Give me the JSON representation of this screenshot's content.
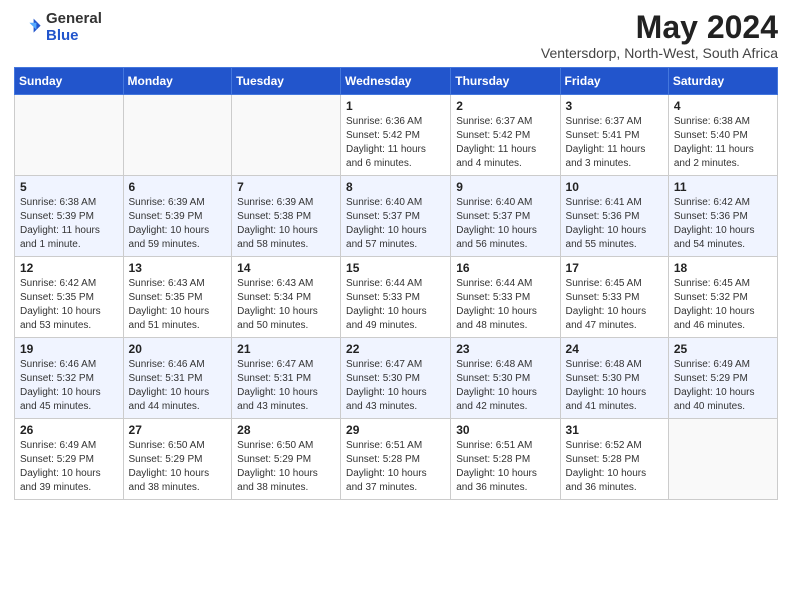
{
  "header": {
    "logo_general": "General",
    "logo_blue": "Blue",
    "month_title": "May 2024",
    "subtitle": "Ventersdorp, North-West, South Africa"
  },
  "days_of_week": [
    "Sunday",
    "Monday",
    "Tuesday",
    "Wednesday",
    "Thursday",
    "Friday",
    "Saturday"
  ],
  "weeks": [
    [
      {
        "day": "",
        "info": ""
      },
      {
        "day": "",
        "info": ""
      },
      {
        "day": "",
        "info": ""
      },
      {
        "day": "1",
        "info": "Sunrise: 6:36 AM\nSunset: 5:42 PM\nDaylight: 11 hours and 6 minutes."
      },
      {
        "day": "2",
        "info": "Sunrise: 6:37 AM\nSunset: 5:42 PM\nDaylight: 11 hours and 4 minutes."
      },
      {
        "day": "3",
        "info": "Sunrise: 6:37 AM\nSunset: 5:41 PM\nDaylight: 11 hours and 3 minutes."
      },
      {
        "day": "4",
        "info": "Sunrise: 6:38 AM\nSunset: 5:40 PM\nDaylight: 11 hours and 2 minutes."
      }
    ],
    [
      {
        "day": "5",
        "info": "Sunrise: 6:38 AM\nSunset: 5:39 PM\nDaylight: 11 hours and 1 minute."
      },
      {
        "day": "6",
        "info": "Sunrise: 6:39 AM\nSunset: 5:39 PM\nDaylight: 10 hours and 59 minutes."
      },
      {
        "day": "7",
        "info": "Sunrise: 6:39 AM\nSunset: 5:38 PM\nDaylight: 10 hours and 58 minutes."
      },
      {
        "day": "8",
        "info": "Sunrise: 6:40 AM\nSunset: 5:37 PM\nDaylight: 10 hours and 57 minutes."
      },
      {
        "day": "9",
        "info": "Sunrise: 6:40 AM\nSunset: 5:37 PM\nDaylight: 10 hours and 56 minutes."
      },
      {
        "day": "10",
        "info": "Sunrise: 6:41 AM\nSunset: 5:36 PM\nDaylight: 10 hours and 55 minutes."
      },
      {
        "day": "11",
        "info": "Sunrise: 6:42 AM\nSunset: 5:36 PM\nDaylight: 10 hours and 54 minutes."
      }
    ],
    [
      {
        "day": "12",
        "info": "Sunrise: 6:42 AM\nSunset: 5:35 PM\nDaylight: 10 hours and 53 minutes."
      },
      {
        "day": "13",
        "info": "Sunrise: 6:43 AM\nSunset: 5:35 PM\nDaylight: 10 hours and 51 minutes."
      },
      {
        "day": "14",
        "info": "Sunrise: 6:43 AM\nSunset: 5:34 PM\nDaylight: 10 hours and 50 minutes."
      },
      {
        "day": "15",
        "info": "Sunrise: 6:44 AM\nSunset: 5:33 PM\nDaylight: 10 hours and 49 minutes."
      },
      {
        "day": "16",
        "info": "Sunrise: 6:44 AM\nSunset: 5:33 PM\nDaylight: 10 hours and 48 minutes."
      },
      {
        "day": "17",
        "info": "Sunrise: 6:45 AM\nSunset: 5:33 PM\nDaylight: 10 hours and 47 minutes."
      },
      {
        "day": "18",
        "info": "Sunrise: 6:45 AM\nSunset: 5:32 PM\nDaylight: 10 hours and 46 minutes."
      }
    ],
    [
      {
        "day": "19",
        "info": "Sunrise: 6:46 AM\nSunset: 5:32 PM\nDaylight: 10 hours and 45 minutes."
      },
      {
        "day": "20",
        "info": "Sunrise: 6:46 AM\nSunset: 5:31 PM\nDaylight: 10 hours and 44 minutes."
      },
      {
        "day": "21",
        "info": "Sunrise: 6:47 AM\nSunset: 5:31 PM\nDaylight: 10 hours and 43 minutes."
      },
      {
        "day": "22",
        "info": "Sunrise: 6:47 AM\nSunset: 5:30 PM\nDaylight: 10 hours and 43 minutes."
      },
      {
        "day": "23",
        "info": "Sunrise: 6:48 AM\nSunset: 5:30 PM\nDaylight: 10 hours and 42 minutes."
      },
      {
        "day": "24",
        "info": "Sunrise: 6:48 AM\nSunset: 5:30 PM\nDaylight: 10 hours and 41 minutes."
      },
      {
        "day": "25",
        "info": "Sunrise: 6:49 AM\nSunset: 5:29 PM\nDaylight: 10 hours and 40 minutes."
      }
    ],
    [
      {
        "day": "26",
        "info": "Sunrise: 6:49 AM\nSunset: 5:29 PM\nDaylight: 10 hours and 39 minutes."
      },
      {
        "day": "27",
        "info": "Sunrise: 6:50 AM\nSunset: 5:29 PM\nDaylight: 10 hours and 38 minutes."
      },
      {
        "day": "28",
        "info": "Sunrise: 6:50 AM\nSunset: 5:29 PM\nDaylight: 10 hours and 38 minutes."
      },
      {
        "day": "29",
        "info": "Sunrise: 6:51 AM\nSunset: 5:28 PM\nDaylight: 10 hours and 37 minutes."
      },
      {
        "day": "30",
        "info": "Sunrise: 6:51 AM\nSunset: 5:28 PM\nDaylight: 10 hours and 36 minutes."
      },
      {
        "day": "31",
        "info": "Sunrise: 6:52 AM\nSunset: 5:28 PM\nDaylight: 10 hours and 36 minutes."
      },
      {
        "day": "",
        "info": ""
      }
    ]
  ]
}
